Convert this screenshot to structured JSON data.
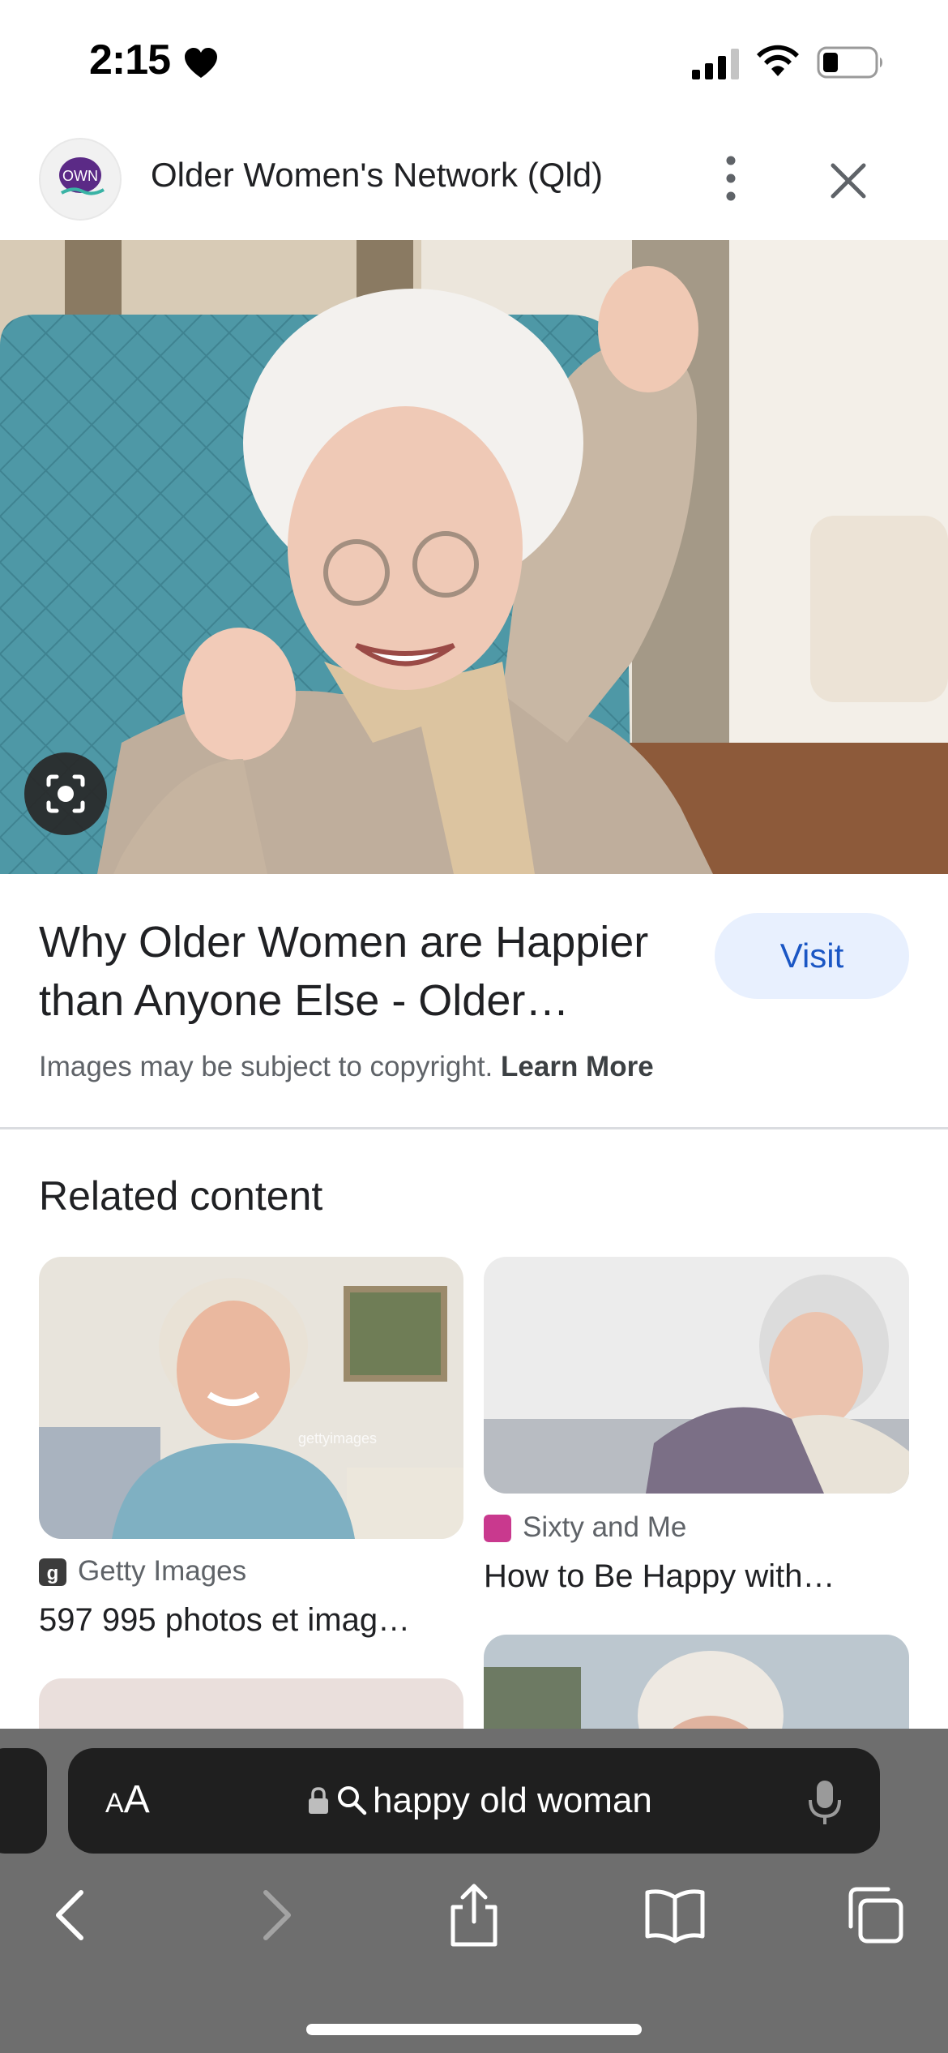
{
  "status_bar": {
    "time": "2:15"
  },
  "header": {
    "site_name": "Older Women's Network (Qld)",
    "logo_text": "OWN"
  },
  "result": {
    "title_line1": "Why Older Women are Happier",
    "title_line2": "than Anyone Else - Older…",
    "visit_label": "Visit",
    "copyright_text": "Images may be subject to copyright.",
    "learn_more_label": "Learn More"
  },
  "related": {
    "section_title": "Related content",
    "cards": [
      {
        "source": "Getty Images",
        "title": "597 995 photos et imag…"
      },
      {
        "source": "Sixty and Me",
        "title": "How to Be Happy with…"
      }
    ],
    "watermark_text": "gettyimages"
  },
  "browser": {
    "aa_small": "A",
    "aa_large": "A",
    "url_query": "happy old woman"
  },
  "colors": {
    "visit_bg": "#e8f0fe",
    "visit_text": "#1a56c4",
    "safari_toolbar": "#6e6e6e",
    "url_bar": "#1f1f1f",
    "sixty_and_me_favicon": "#c9398e"
  }
}
